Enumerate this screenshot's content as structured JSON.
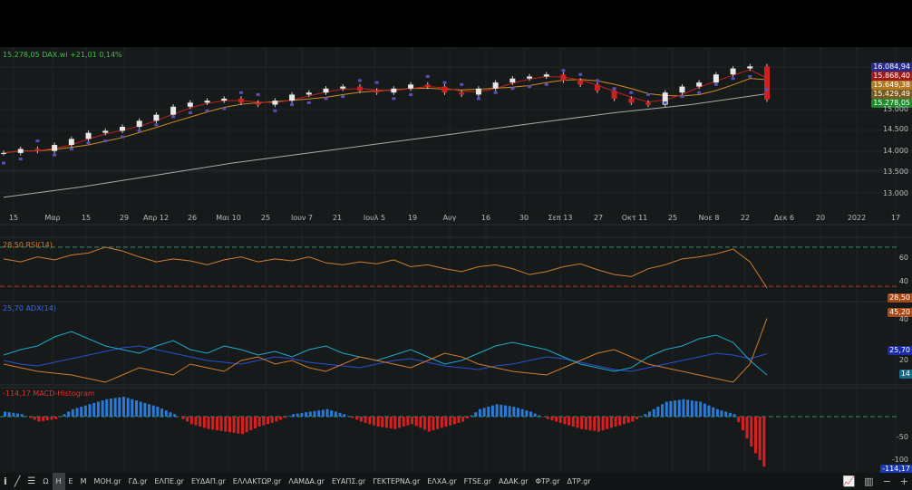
{
  "header": {
    "quote": "15.278,05 DAX.wi +21,01 0,14%"
  },
  "price_axis": {
    "ticks": [
      "15.000",
      "14.500",
      "14.000",
      "13.500",
      "13.000"
    ],
    "tags": [
      {
        "v": "16.084,94",
        "c": "#2a2a8a"
      },
      {
        "v": "15.868,40",
        "c": "#a01818"
      },
      {
        "v": "15.649,38",
        "c": "#b07a20"
      },
      {
        "v": "15.429,49",
        "c": "#7a5a20"
      },
      {
        "v": "15.278,05",
        "c": "#1a8a2a"
      }
    ]
  },
  "x_axis": [
    "15",
    "Μαρ",
    "15",
    "29",
    "Απρ 12",
    "26",
    "Μαι 10",
    "25",
    "Ιουν 7",
    "21",
    "Ιουλ 5",
    "19",
    "Αυγ",
    "16",
    "30",
    "Σεπ 13",
    "27",
    "Οκτ 11",
    "25",
    "Νοε 8",
    "22",
    "Δεκ 6",
    "20",
    "2022",
    "17"
  ],
  "rsi": {
    "label": "28,50 RSI(14)",
    "ticks": [
      "60",
      "40"
    ],
    "tag": "28,50"
  },
  "adx": {
    "label": "25,70 ADX(14)",
    "ticks": [
      "40",
      "20"
    ],
    "tags": [
      "45,20",
      "25,70",
      "14"
    ]
  },
  "macd": {
    "label": "-114,17 MACD-Histogram",
    "ticks": [
      "-50",
      "-100"
    ],
    "tag": "-114,17"
  },
  "toolbar": {
    "items": [
      "Ω",
      "Η",
      "Ε",
      "Μ",
      "ΜΟΗ.gr",
      "ΓΔ.gr",
      "ΕΛΠΕ.gr",
      "ΕΥΔΑΠ.gr",
      "ΕΛΛΑΚΤΩΡ.gr",
      "ΛΑΜΔΑ.gr",
      "ΕΥΑΠΣ.gr",
      "ΓΕΚΤΕΡΝΑ.gr",
      "ΕΛΧΑ.gr",
      "FTSE.gr",
      "ΑΔΑΚ.gr",
      "ΦΤΡ.gr",
      "ΔΤΡ.gr"
    ],
    "active": "Η"
  },
  "chart_data": {
    "type": "line",
    "title": "DAX.wi",
    "ylim": [
      12800,
      16400
    ],
    "close": [
      13950,
      14050,
      14000,
      14150,
      14300,
      14450,
      14500,
      14600,
      14750,
      14900,
      15100,
      15200,
      15250,
      15300,
      15200,
      15150,
      15250,
      15400,
      15450,
      15550,
      15600,
      15500,
      15450,
      15550,
      15650,
      15600,
      15450,
      15400,
      15550,
      15700,
      15800,
      15850,
      15900,
      15750,
      15650,
      15500,
      15300,
      15200,
      15150,
      15450,
      15600,
      15700,
      15900,
      16050,
      16100,
      15278
    ],
    "sma200": [
      12850,
      13100,
      13400,
      13700,
      13950,
      14200,
      14450,
      14700,
      14950,
      15150,
      15420
    ],
    "rsi": [
      58,
      55,
      60,
      57,
      62,
      64,
      70,
      66,
      60,
      55,
      58,
      56,
      52,
      57,
      60,
      55,
      58,
      56,
      60,
      54,
      52,
      55,
      53,
      57,
      50,
      52,
      48,
      45,
      50,
      52,
      48,
      42,
      45,
      50,
      53,
      47,
      42,
      40,
      48,
      52,
      58,
      60,
      63,
      68,
      55,
      28.5
    ],
    "adx": [
      22,
      20,
      19,
      21,
      23,
      25,
      27,
      29,
      30,
      28,
      26,
      24,
      22,
      21,
      20,
      22,
      24,
      23,
      21,
      20,
      19,
      18,
      20,
      22,
      23,
      21,
      19,
      18,
      17,
      19,
      20,
      22,
      24,
      23,
      21,
      19,
      17,
      16,
      18,
      20,
      22,
      24,
      26,
      25,
      23,
      25.7
    ],
    "di_plus": [
      25,
      28,
      30,
      35,
      38,
      34,
      30,
      28,
      26,
      30,
      33,
      28,
      26,
      30,
      28,
      25,
      27,
      24,
      28,
      30,
      26,
      24,
      22,
      25,
      28,
      24,
      20,
      22,
      26,
      30,
      32,
      30,
      28,
      24,
      20,
      18,
      16,
      18,
      24,
      28,
      30,
      34,
      36,
      32,
      22,
      14
    ],
    "di_minus": [
      20,
      18,
      16,
      15,
      14,
      12,
      10,
      14,
      18,
      16,
      14,
      20,
      18,
      16,
      22,
      24,
      20,
      22,
      18,
      16,
      20,
      24,
      22,
      20,
      18,
      22,
      26,
      24,
      20,
      18,
      16,
      15,
      14,
      18,
      22,
      26,
      28,
      24,
      20,
      18,
      16,
      14,
      12,
      10,
      20,
      45.2
    ],
    "macd_hist": [
      10,
      5,
      -10,
      -5,
      15,
      25,
      35,
      40,
      30,
      20,
      5,
      -15,
      -25,
      -30,
      -35,
      -20,
      -10,
      5,
      10,
      15,
      5,
      -10,
      -20,
      -25,
      -15,
      -30,
      -20,
      -10,
      15,
      25,
      20,
      10,
      -5,
      -15,
      -25,
      -30,
      -20,
      -10,
      10,
      30,
      35,
      30,
      15,
      5,
      -60,
      -114
    ]
  }
}
